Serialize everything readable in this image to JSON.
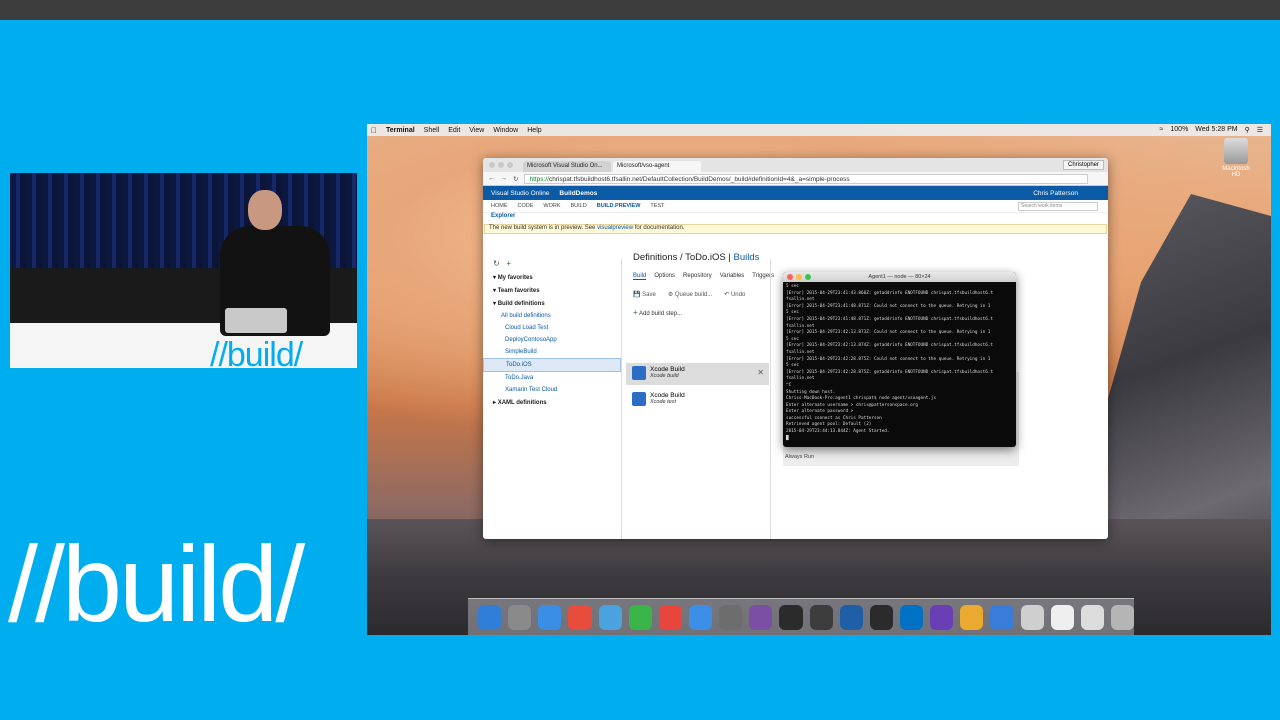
{
  "event_logo": "//build/",
  "camera_logo": "//build/",
  "mac_menubar": {
    "app": "Terminal",
    "items": [
      "Shell",
      "Edit",
      "View",
      "Window",
      "Help"
    ],
    "status": [
      "100%",
      "Wed 5:28 PM"
    ]
  },
  "desktop_drive_label": "Macintosh HD",
  "browser": {
    "tabs": [
      "Microsoft Visual Studio On...",
      "Microsoft/vso-agent"
    ],
    "profile": "Christopher",
    "url_https": "https://",
    "url_rest": "chrispat.tfsbuildhost6.tfsallin.net/DefaultCollection/BuildDemos/_build#definitionId=4&_a=simple-process"
  },
  "vso": {
    "product": "Visual Studio Online",
    "project": "BuildDemos",
    "user": "Chris Patterson",
    "hubs": [
      "HOME",
      "CODE",
      "WORK",
      "BUILD",
      "BUILD.PREVIEW",
      "TEST"
    ],
    "search_placeholder": "Search work items",
    "explorer_tab": "Explorer",
    "banner_text": "The new build system is in preview. See",
    "banner_link": "visualpreview",
    "banner_tail": "for documentation."
  },
  "sidebar": {
    "items": [
      {
        "label": "My favorites",
        "level": 1
      },
      {
        "label": "Team favorites",
        "level": 1
      },
      {
        "label": "Build definitions",
        "level": 1
      },
      {
        "label": "All build definitions",
        "level": 2
      },
      {
        "label": "Cloud Load Test",
        "level": 3
      },
      {
        "label": "DeployContosoApp",
        "level": 3
      },
      {
        "label": "SimpleBuild",
        "level": 3
      },
      {
        "label": "ToDo.iOS",
        "level": 3
      },
      {
        "label": "ToDo.Java",
        "level": 3
      },
      {
        "label": "Xamarin Test Cloud",
        "level": 3
      },
      {
        "label": "XAML definitions",
        "level": 1
      }
    ]
  },
  "definition": {
    "crumb_root": "Definitions /",
    "crumb_name": "ToDo.iOS",
    "crumb_sep": "|",
    "crumb_current": "Builds",
    "tabs": [
      "Build",
      "Options",
      "Repository",
      "Variables",
      "Triggers"
    ],
    "actions": [
      "Save",
      "Queue build...",
      "Undo"
    ],
    "add_step": "Add build step...",
    "steps": [
      {
        "title": "Xcode Build",
        "subtitle": "Xcode build"
      },
      {
        "title": "Xcode Build",
        "subtitle": "Xcode test"
      }
    ],
    "always_run": "Always Run"
  },
  "terminal": {
    "title": "Agent1 — node — 80×24",
    "lines": [
      "5 sec",
      "[Error] 2015-04-29T23:41:43.860Z: getaddrinfo ENOTFOUND chrispat.tfsbuildhost6.t",
      "fsallin.net",
      "[Error] 2015-04-29T23:41:48.871Z: Could not connect to the queue. Retrying in 1",
      "5 sec",
      "[Error] 2015-04-29T23:41:48.871Z: getaddrinfo ENOTFOUND chrispat.tfsbuildhost6.t",
      "fsallin.net",
      "[Error] 2015-04-29T23:42:13.873Z: Could not connect to the queue. Retrying in 1",
      "5 sec",
      "[Error] 2015-04-29T23:42:13.874Z: getaddrinfo ENOTFOUND chrispat.tfsbuildhost6.t",
      "fsallin.net",
      "[Error] 2015-04-29T23:42:28.875Z: Could not connect to the queue. Retrying in 1",
      "5 sec",
      "[Error] 2015-04-29T23:42:28.875Z: getaddrinfo ENOTFOUND chrispat.tfsbuildhost6.t",
      "fsallin.net",
      "^C",
      "Shutting down host.",
      "Chriss-MacBook-Pro:agent1 chrispat$ node agent/vsoagent.js",
      "Enter alternate username > chris@pattersonspace.org",
      "Enter alternate password >",
      "successful connect as Chris Patterson",
      "Retrieved agent pool: Default (2)",
      "2015-04-29T23:44:13.844Z: Agent Started.",
      "█"
    ]
  },
  "dock_colors": [
    "#2f7fd6",
    "#8a8a8a",
    "#3a8ee6",
    "#e84c3d",
    "#4aa3df",
    "#39b54a",
    "#e8463c",
    "#3b8fe6",
    "#6d6d6d",
    "#7b4fa3",
    "#2b2b2b",
    "#3d3d3d",
    "#1f5fa8",
    "#2b2b2b",
    "#0072c6",
    "#6a3fb5",
    "#e9aa2f",
    "#3a7dd8",
    "#cfcfcf",
    "#efefef",
    "#dcdcdc",
    "#b5b5b5"
  ]
}
